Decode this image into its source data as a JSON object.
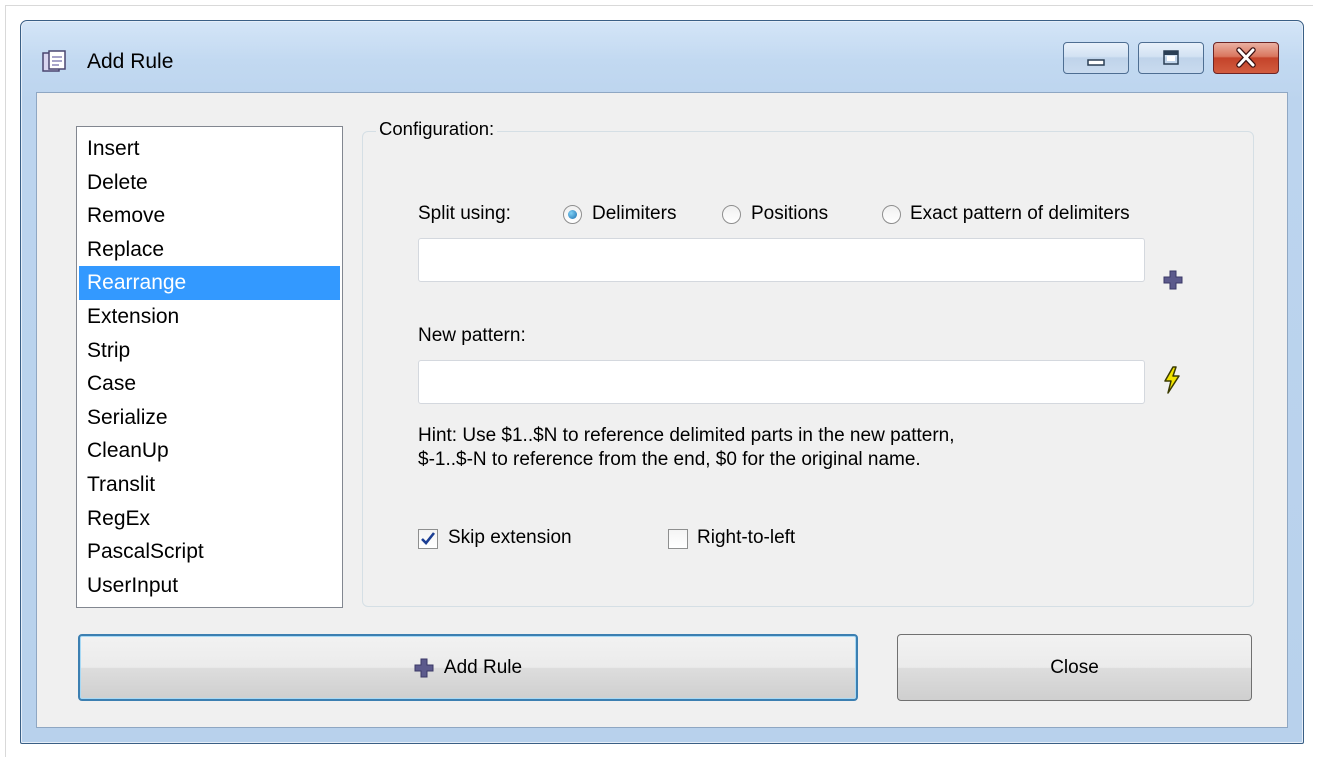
{
  "window": {
    "title": "Add Rule"
  },
  "rules": {
    "items": [
      "Insert",
      "Delete",
      "Remove",
      "Replace",
      "Rearrange",
      "Extension",
      "Strip",
      "Case",
      "Serialize",
      "CleanUp",
      "Translit",
      "RegEx",
      "PascalScript",
      "UserInput"
    ],
    "selected": "Rearrange"
  },
  "config": {
    "legend": "Configuration:",
    "split_label": "Split using:",
    "options": {
      "delimiters": "Delimiters",
      "positions": "Positions",
      "exact": "Exact pattern of delimiters"
    },
    "selected_option": "Delimiters",
    "split_value": "",
    "new_pattern_label": "New pattern:",
    "new_pattern_value": "",
    "hint_line1": "Hint: Use $1..$N to reference delimited parts in the new pattern,",
    "hint_line2": "$-1..$-N to reference from the end, $0 for the original name.",
    "skip_extension_label": "Skip extension",
    "skip_extension_checked": true,
    "right_to_left_label": "Right-to-left",
    "right_to_left_checked": false
  },
  "buttons": {
    "add_rule": "Add Rule",
    "close": "Close"
  },
  "colors": {
    "selection": "#3399ff",
    "plus_icon": "#5c5a8c",
    "lightning_icon": "#e8d200"
  }
}
